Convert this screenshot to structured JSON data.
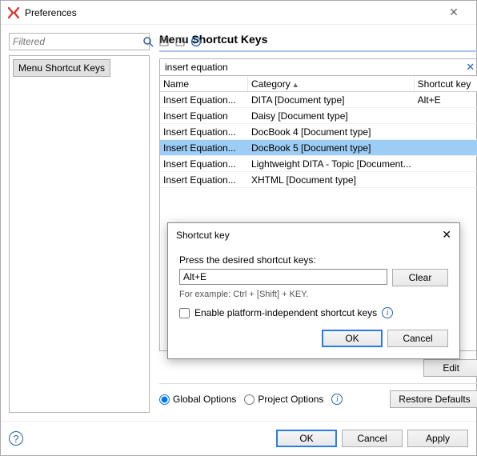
{
  "window": {
    "title": "Preferences"
  },
  "left": {
    "filter_placeholder": "Filtered",
    "tree_item": "Menu Shortcut Keys"
  },
  "section": {
    "title": "Menu Shortcut Keys"
  },
  "search": {
    "value": "insert equation"
  },
  "table": {
    "headers": {
      "name": "Name",
      "category": "Category",
      "shortcut": "Shortcut key"
    },
    "rows": [
      {
        "name": "Insert Equation...",
        "category": "DITA [Document type]",
        "shortcut": "Alt+E",
        "selected": false
      },
      {
        "name": "Insert Equation",
        "category": "Daisy [Document type]",
        "shortcut": "",
        "selected": false
      },
      {
        "name": "Insert Equation...",
        "category": "DocBook 4 [Document type]",
        "shortcut": "",
        "selected": false
      },
      {
        "name": "Insert Equation...",
        "category": "DocBook 5 [Document type]",
        "shortcut": "",
        "selected": true
      },
      {
        "name": "Insert Equation...",
        "category": "Lightweight DITA - Topic [Document...",
        "shortcut": "",
        "selected": false
      },
      {
        "name": "Insert Equation...",
        "category": "XHTML [Document type]",
        "shortcut": "",
        "selected": false
      }
    ]
  },
  "buttons": {
    "edit": "Edit",
    "restore": "Restore Defaults",
    "ok": "OK",
    "cancel": "Cancel",
    "apply": "Apply",
    "clear": "Clear"
  },
  "options": {
    "global": "Global Options",
    "project": "Project Options"
  },
  "dialog": {
    "title": "Shortcut key",
    "prompt": "Press the desired shortcut keys:",
    "value": "Alt+E",
    "hint": "For example: Ctrl + [Shift] + KEY.",
    "checkbox": "Enable platform-independent shortcut keys",
    "ok": "OK",
    "cancel": "Cancel"
  }
}
